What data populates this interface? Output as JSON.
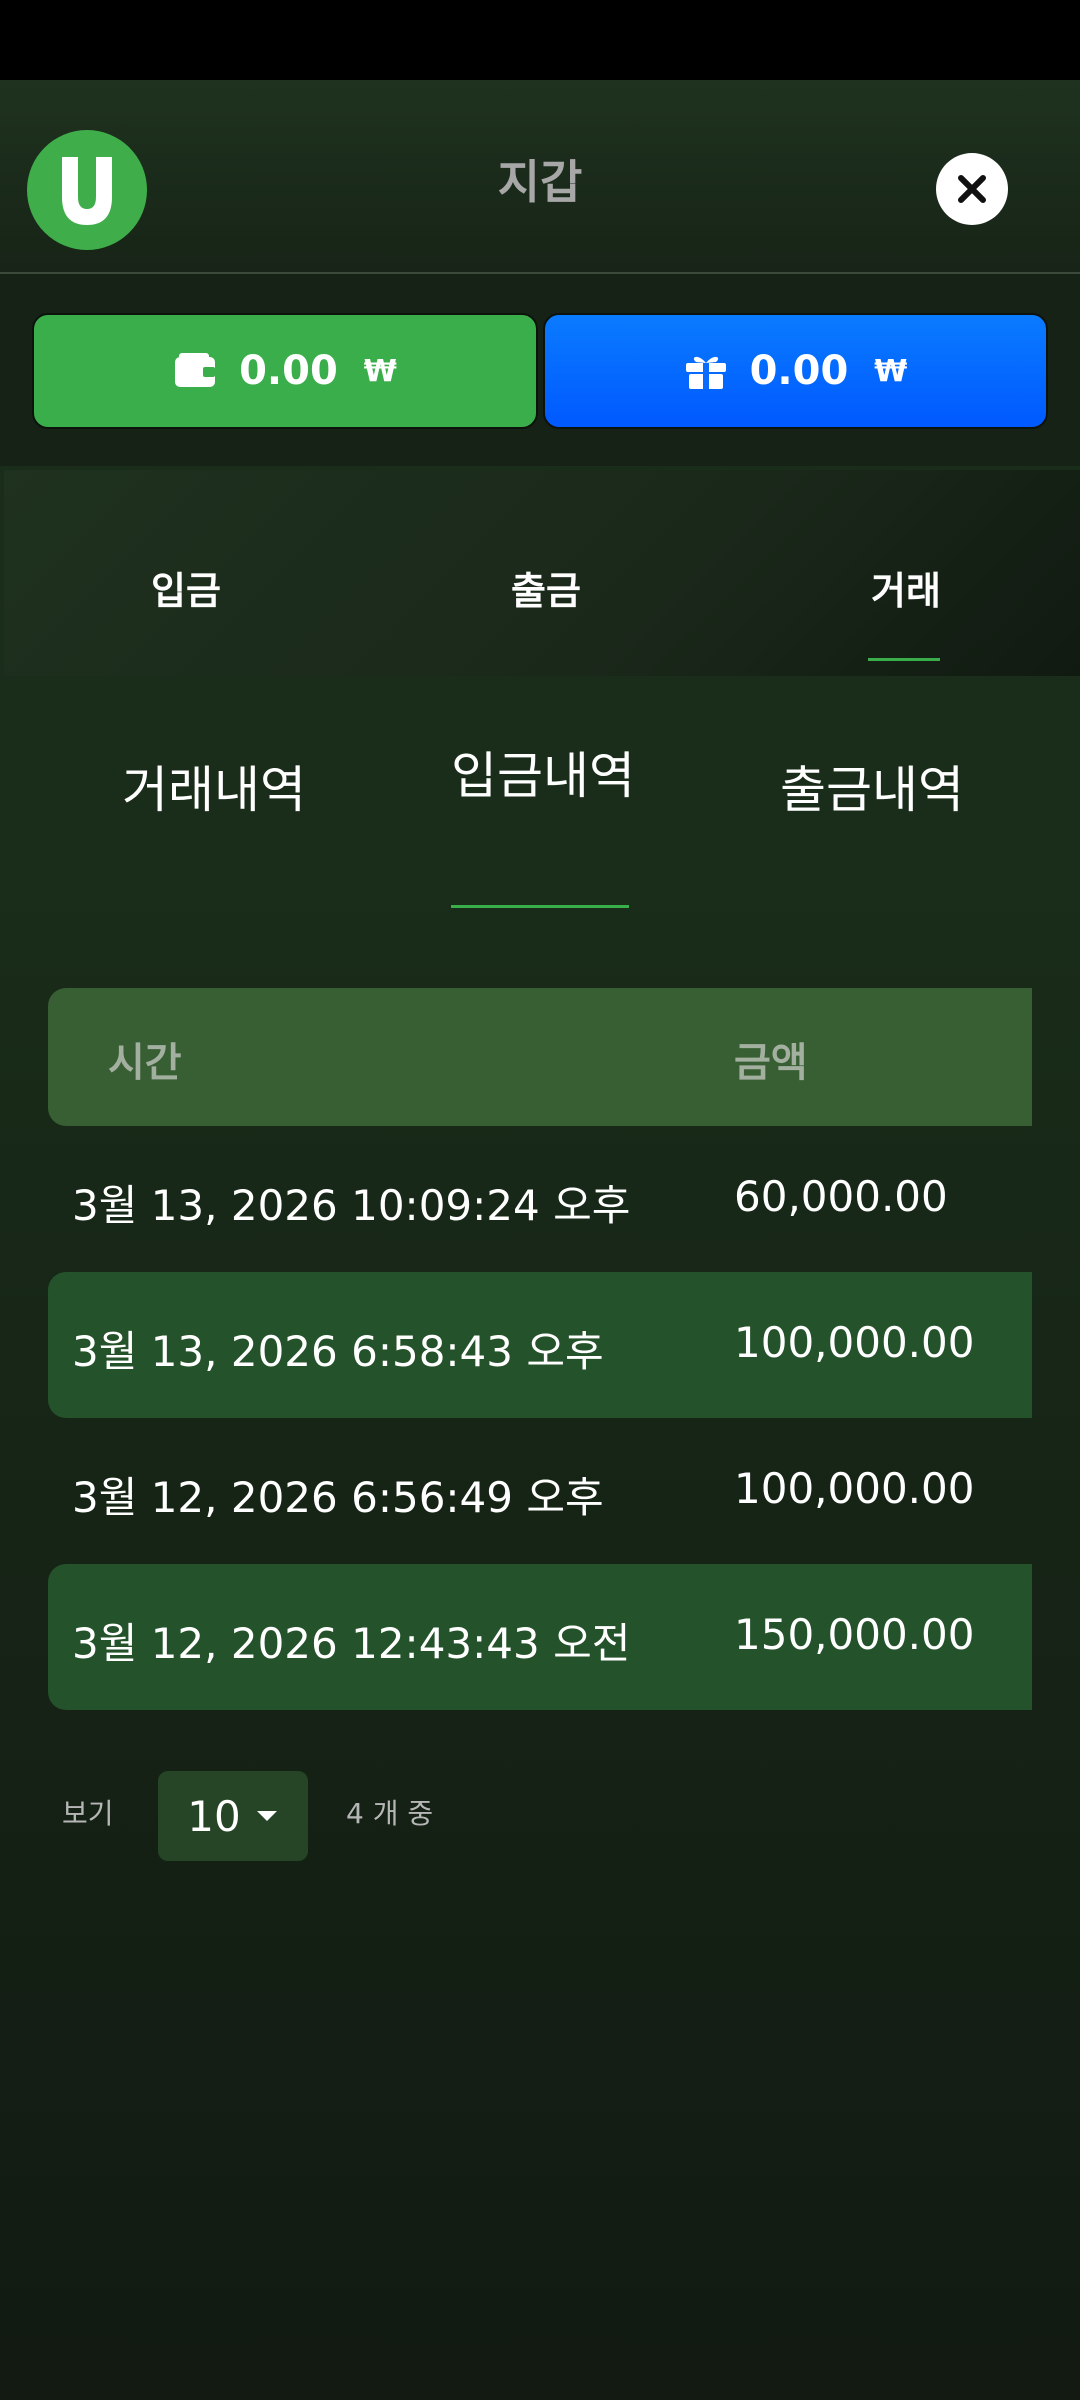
{
  "header": {
    "title": "지갑"
  },
  "balances": {
    "cash": {
      "amount": "0.00",
      "currency": "₩"
    },
    "bonus": {
      "amount": "0.00",
      "currency": "₩"
    }
  },
  "main_tabs": [
    {
      "label": "입금",
      "active": false
    },
    {
      "label": "출금",
      "active": false
    },
    {
      "label": "거래",
      "active": true
    }
  ],
  "sub_tabs": [
    {
      "label": "거래내역",
      "active": false
    },
    {
      "label": "입금내역",
      "active": true
    },
    {
      "label": "출금내역",
      "active": false
    }
  ],
  "table": {
    "columns": [
      "시간",
      "금액"
    ],
    "rows": [
      {
        "time": "3월 13, 2026 10:09:24 오후",
        "amount": "60,000.00"
      },
      {
        "time": "3월 13, 2026 6:58:43 오후",
        "amount": "100,000.00"
      },
      {
        "time": "3월 12, 2026 6:56:49 오후",
        "amount": "100,000.00"
      },
      {
        "time": "3월 12, 2026 12:43:43 오전",
        "amount": "150,000.00"
      }
    ]
  },
  "pager": {
    "show_label": "보기",
    "page_size": "10",
    "total_text": "4 개 중"
  },
  "colors": {
    "accent": "#3aae4a",
    "bonus": "#0066ff",
    "row_alt": "#24522a",
    "header_row": "#385e33"
  }
}
